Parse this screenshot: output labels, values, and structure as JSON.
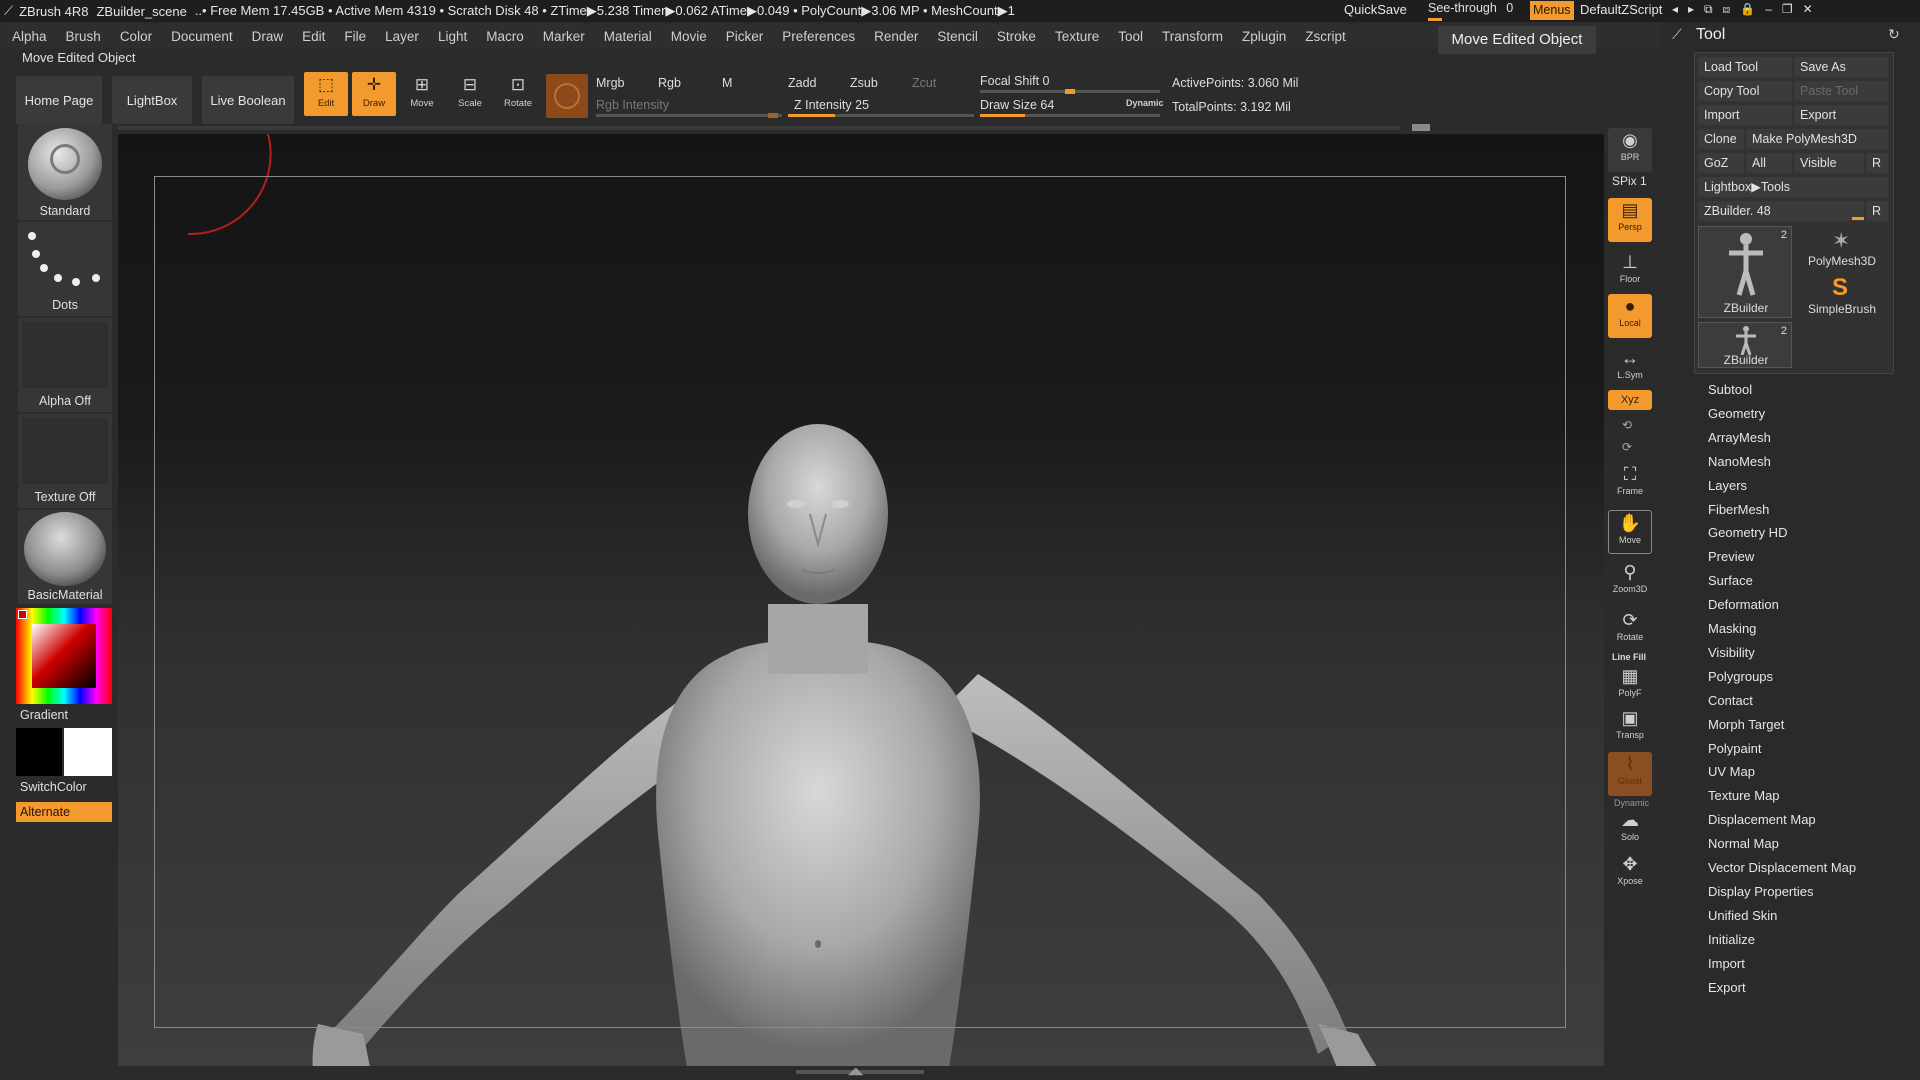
{
  "topbar": {
    "app": "ZBrush 4R8",
    "scene": "ZBuilder_scene",
    "stats": "..• Free Mem 17.45GB • Active Mem 4319 • Scratch Disk 48 • ZTime▶5.238 Timer▶0.062 ATime▶0.049 • PolyCount▶3.06 MP • MeshCount▶1",
    "quicksave": "QuickSave",
    "seethrough_label": "See-through",
    "seethrough_value": "0",
    "menus": "Menus",
    "script": "DefaultZScript"
  },
  "menubar": [
    "Alpha",
    "Brush",
    "Color",
    "Document",
    "Draw",
    "Edit",
    "File",
    "Layer",
    "Light",
    "Macro",
    "Marker",
    "Material",
    "Movie",
    "Picker",
    "Preferences",
    "Render",
    "Stencil",
    "Stroke",
    "Texture",
    "Tool",
    "Transform",
    "Zplugin",
    "Zscript"
  ],
  "status_text": "Move Edited Object",
  "tooltip": "Move Edited Object",
  "toolbar": {
    "home": "Home Page",
    "lightbox": "LightBox",
    "live_boolean": "Live Boolean",
    "edit": "Edit",
    "draw": "Draw",
    "move": "Move",
    "scale": "Scale",
    "rotate": "Rotate",
    "mrgb": "Mrgb",
    "rgb": "Rgb",
    "m": "M",
    "rgb_intensity": "Rgb Intensity",
    "zadd": "Zadd",
    "zsub": "Zsub",
    "zcut": "Zcut",
    "z_intensity": "Z Intensity 25",
    "focal_shift": "Focal Shift 0",
    "draw_size": "Draw Size 64",
    "dynamic": "Dynamic",
    "active_points": "ActivePoints: 3.060 Mil",
    "total_points": "TotalPoints: 3.192 Mil",
    "z_intensity_level": 0.25,
    "draw_size_level": 0.25,
    "focal_shift_level": 0.5
  },
  "left_palette": {
    "brush": "Standard",
    "stroke": "Dots",
    "alpha": "Alpha Off",
    "texture": "Texture Off",
    "material": "BasicMaterial",
    "gradient": "Gradient",
    "switchcolor": "SwitchColor",
    "alternate": "Alternate"
  },
  "shelf": {
    "bpr": "BPR",
    "spix": "SPix 1",
    "persp": "Persp",
    "floor": "Floor",
    "local": "Local",
    "lsym": "L.Sym",
    "xyz": "Xyz",
    "frame": "Frame",
    "move": "Move",
    "zoom3d": "Zoom3D",
    "rotate": "Rotate",
    "linefill": "Line Fill",
    "polyf": "PolyF",
    "transp": "Transp",
    "ghost": "Ghost",
    "dynamic": "Dynamic",
    "solo": "Solo",
    "xpose": "Xpose"
  },
  "tool_panel": {
    "title": "Tool",
    "load_tool": "Load Tool",
    "save_as": "Save As",
    "copy_tool": "Copy Tool",
    "paste_tool": "Paste Tool",
    "import": "Import",
    "export": "Export",
    "clone": "Clone",
    "make_polymesh": "Make PolyMesh3D",
    "goz": "GoZ",
    "all": "All",
    "visible": "Visible",
    "r": "R",
    "lightbox_tools": "Lightbox▶Tools",
    "zbuilder_slider": "ZBuilder. 48",
    "thumb1_count": "2",
    "thumb1_label": "ZBuilder",
    "thumb2_label": "PolyMesh3D",
    "thumb3_label": "SimpleBrush",
    "thumb4_count": "2",
    "thumb4_label": "ZBuilder",
    "items": [
      "Subtool",
      "Geometry",
      "ArrayMesh",
      "NanoMesh",
      "Layers",
      "FiberMesh",
      "Geometry HD",
      "Preview",
      "Surface",
      "Deformation",
      "Masking",
      "Visibility",
      "Polygroups",
      "Contact",
      "Morph Target",
      "Polypaint",
      "UV Map",
      "Texture Map",
      "Displacement Map",
      "Normal Map",
      "Vector Displacement Map",
      "Display Properties",
      "Unified Skin",
      "Initialize",
      "Import",
      "Export"
    ]
  },
  "colors": {
    "accent": "#f39a2f",
    "panel": "#2a2a2a",
    "bar": "#1e1e1e"
  }
}
